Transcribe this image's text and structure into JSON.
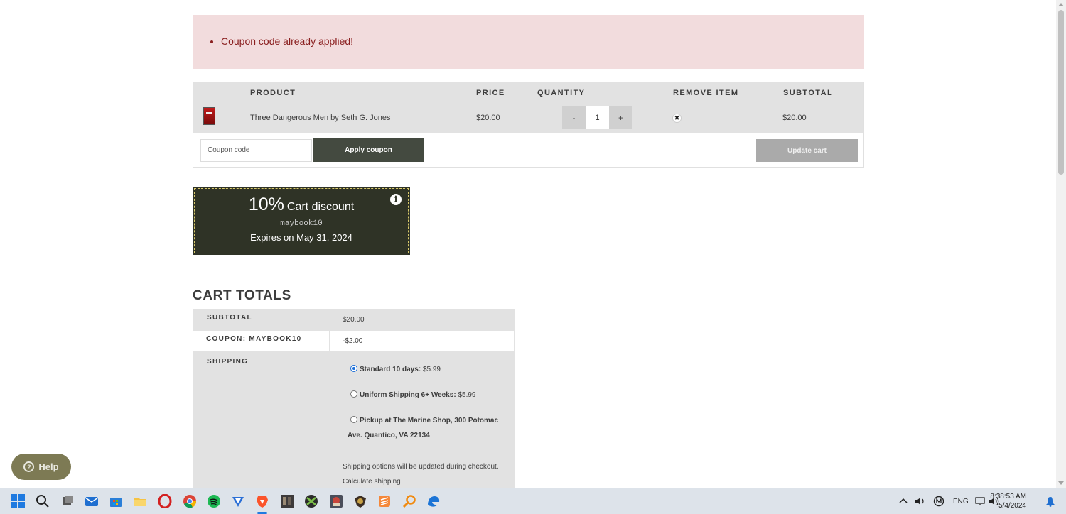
{
  "notice": {
    "message": "Coupon code already applied!"
  },
  "cart": {
    "headers": {
      "product": "PRODUCT",
      "price": "PRICE",
      "quantity": "QUANTITY",
      "remove": "REMOVE ITEM",
      "subtotal": "SUBTOTAL"
    },
    "item": {
      "name": "Three Dangerous Men by Seth G. Jones",
      "price": "$20.00",
      "quantity": "1",
      "subtotal": "$20.00",
      "remove_symbol": "✖"
    },
    "qty_minus": "-",
    "qty_plus": "+",
    "coupon_placeholder": "Coupon code",
    "apply_label": "Apply coupon",
    "update_label": "Update cart"
  },
  "coupon_card": {
    "percent": "10%",
    "type": "Cart discount",
    "code": "maybook10",
    "expires": "Expires on May 31, 2024",
    "info_symbol": "i"
  },
  "totals": {
    "title": "CART TOTALS",
    "subtotal_label": "SUBTOTAL",
    "subtotal_value": "$20.00",
    "coupon_label": "COUPON: MAYBOOK10",
    "coupon_value": "-$2.00",
    "shipping_label": "SHIPPING",
    "options": [
      {
        "name": "Standard 10 days:",
        "price": "$5.99",
        "selected": true
      },
      {
        "name": "Uniform Shipping 6+ Weeks:",
        "price": "$5.99",
        "selected": false
      },
      {
        "name": "Pickup at The Marine Shop, 300 Potomac",
        "name2": "Ave. Quantico, VA 22134",
        "selected": false
      }
    ],
    "shipping_note": "Shipping options will be updated during checkout.",
    "calculate_label": "Calculate shipping"
  },
  "help": {
    "label": "Help"
  },
  "taskbar": {
    "language": "ENG",
    "time": "8:38:53 AM",
    "date": "5/4/2024",
    "icons": [
      "windows-start-icon",
      "search-icon",
      "task-view-icon",
      "mail-icon",
      "store-icon",
      "file-explorer-icon",
      "opera-icon",
      "chrome-icon",
      "spotify-icon",
      "vpn-icon",
      "brave-icon",
      "game-icon",
      "xbox-icon",
      "game-icon-2",
      "game-icon-3",
      "sublime-icon",
      "search-tool-icon",
      "edge-icon"
    ]
  }
}
